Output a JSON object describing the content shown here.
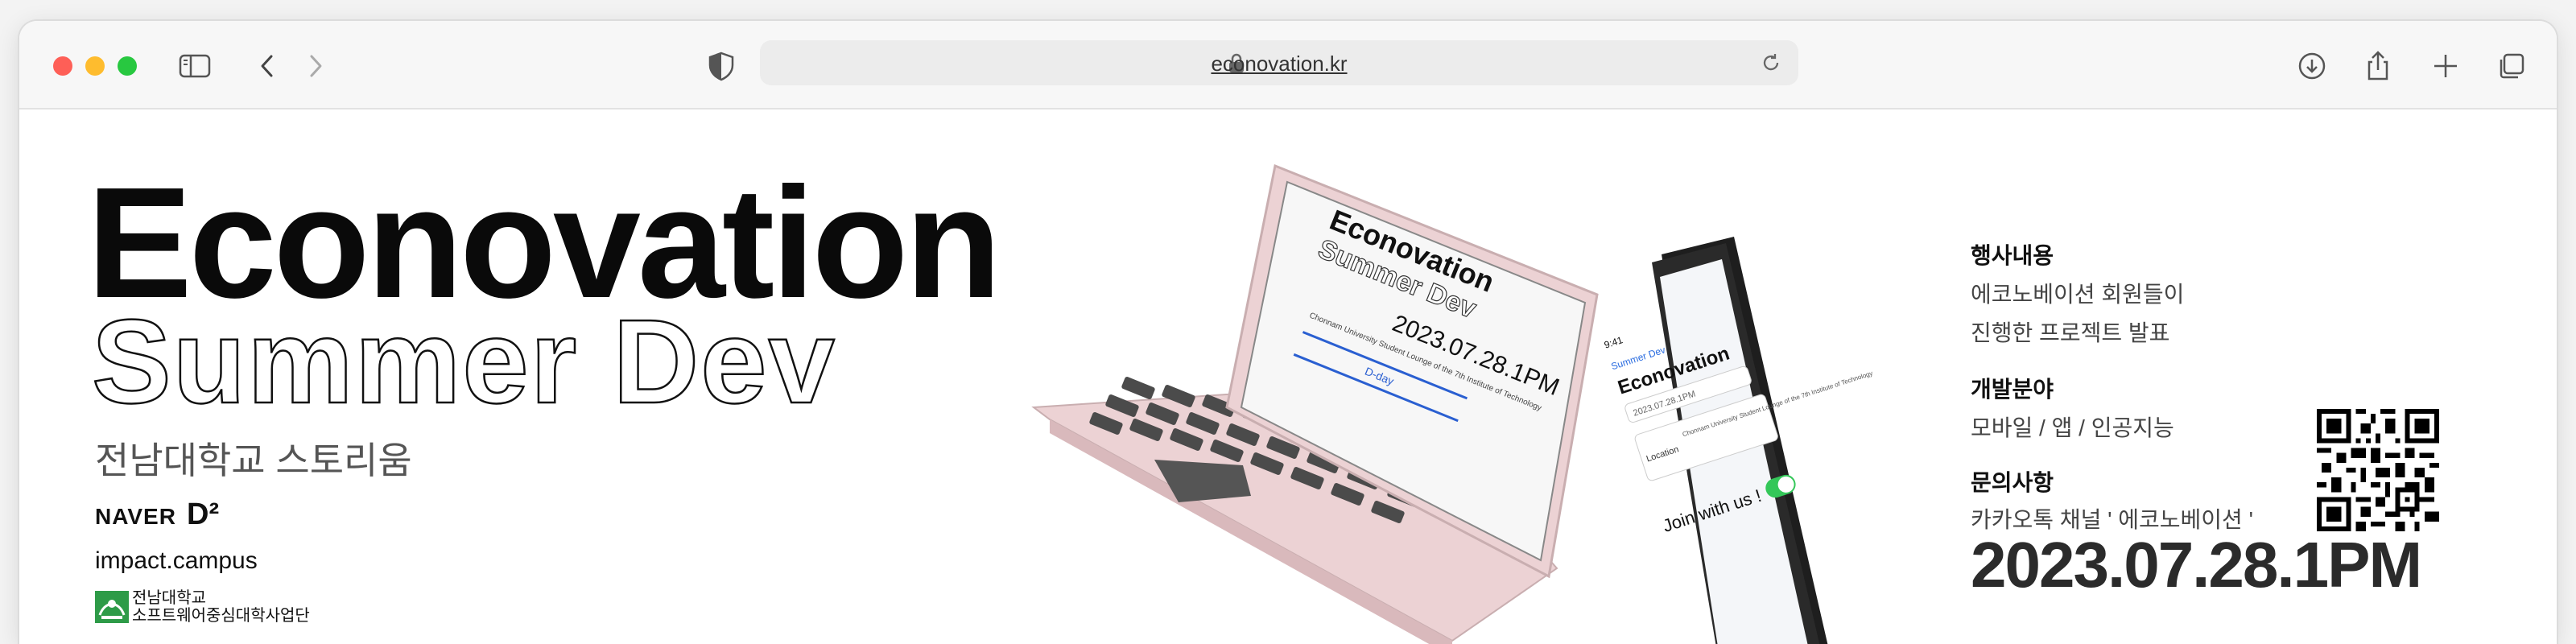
{
  "browser": {
    "url": "econovation.kr",
    "icons": [
      "sidebar-icon",
      "back-icon",
      "forward-icon",
      "shield-icon",
      "lock-icon",
      "reload-icon",
      "download-icon",
      "share-icon",
      "new-tab-icon",
      "tabs-icon"
    ]
  },
  "hero": {
    "title": "Econovation",
    "subtitle": "Summer Dev",
    "venue": "전남대학교 스토리움"
  },
  "sponsors": {
    "naver": "NAVER",
    "d2": "D²",
    "impact": "impact.campus",
    "jnu_line1": "전남대학교",
    "jnu_line2": "소프트웨어중심대학사업단"
  },
  "devices": {
    "laptop_title": "Econovation",
    "laptop_sub": "Summer Dev",
    "laptop_date": "2023.07.28.1PM",
    "laptop_location": "Chonnam University Student Lounge of the 7th Institute of Technology",
    "laptop_dday": "D-day",
    "phone_title": "Econovation",
    "phone_back": "Summer Dev",
    "phone_date": "2023.07.28.1PM",
    "phone_location_label": "Location",
    "phone_location": "Chonnam University Student Lounge of the 7th Institute of Technology",
    "phone_join": "Join with us !",
    "phone_time": "9:41"
  },
  "info": {
    "event_heading": "행사내용",
    "event_line1": "에코노베이션 회원들이",
    "event_line2": "진행한 프로젝트 발표",
    "field_heading": "개발분야",
    "field_text": "모바일 / 앱 / 인공지능",
    "contact_heading": "문의사항",
    "contact_text": "카카오톡 채널 ' 에코노베이션 '",
    "date": "2023.07.28.1PM"
  },
  "colors": {
    "traffic_red": "#fe5f57",
    "traffic_yellow": "#febc2e",
    "traffic_green": "#28c840",
    "laptop_body": "#f0d6d8",
    "toggle_green": "#34c759"
  }
}
